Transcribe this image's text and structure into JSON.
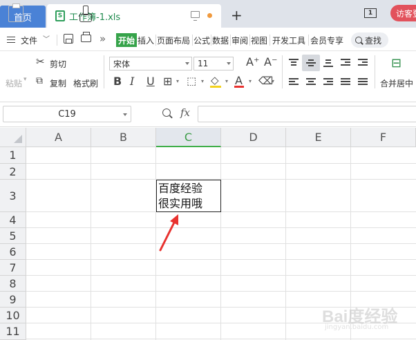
{
  "titlebar": {
    "home_tab": "首页",
    "doc_tab": "工作簿-1.xls",
    "file_icon_letter": "S",
    "new_tab": "+",
    "page_indicator": "1",
    "visitor_button": "访客登"
  },
  "menu": {
    "file": "文件",
    "more": "»",
    "tabs": [
      "开始",
      "插入",
      "页面布局",
      "公式",
      "数据",
      "审阅",
      "视图",
      "开发工具",
      "会员专享"
    ],
    "search": "查找"
  },
  "ribbon": {
    "paste": "粘贴",
    "cut": "剪切",
    "copy": "复制",
    "format_painter": "格式刷",
    "font_name": "宋体",
    "font_size": "11",
    "bold": "B",
    "italic": "I",
    "underline": "U",
    "grow_font": "A⁺",
    "shrink_font": "A⁻",
    "font_color_letter": "A",
    "merge_center": "合并居中"
  },
  "formula_bar": {
    "name_box": "C19",
    "fx_label": "fx",
    "formula_value": ""
  },
  "grid": {
    "columns": [
      "A",
      "B",
      "C",
      "D",
      "E",
      "F"
    ],
    "selected_column": "C",
    "rows": [
      "1",
      "2",
      "3",
      "4",
      "5",
      "6",
      "7",
      "8",
      "9",
      "10",
      "11"
    ],
    "cell_c3_line1": "百度经验",
    "cell_c3_line2": "很实用哦"
  },
  "watermark": {
    "brand": "Bai度经验",
    "url": "jingyan.baidu.com"
  },
  "colors": {
    "accent_green": "#3fae49",
    "home_tab_blue": "#4a82d6",
    "visitor_red": "#e2525c",
    "arrow_red": "#e8322f"
  }
}
